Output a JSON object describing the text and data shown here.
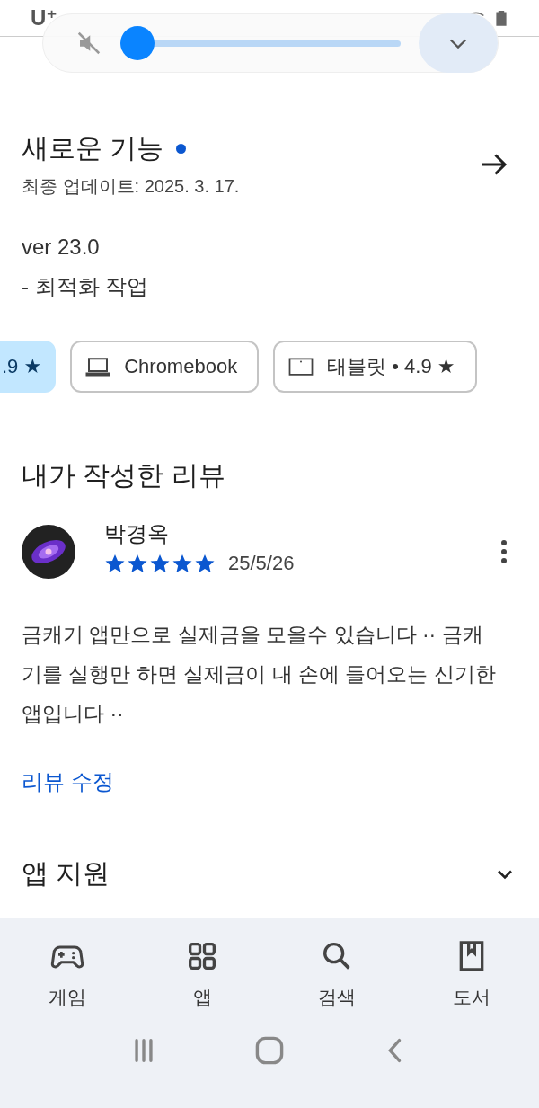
{
  "status_bar": {
    "carrier": "U⁺"
  },
  "volume_panel": {
    "muted": true,
    "level": 0
  },
  "whats_new": {
    "title": "새로운 기능",
    "unread": true,
    "updated": "최종 업데이트: 2025. 3. 17.",
    "version": "ver 23.0",
    "notes": "- 최적화 작업"
  },
  "device_chips": [
    {
      "kind": "phone",
      "label": ".9 ★",
      "selected": true
    },
    {
      "kind": "laptop",
      "label": "Chromebook",
      "selected": false
    },
    {
      "kind": "tablet",
      "label": "태블릿 • 4.9 ★",
      "selected": false
    }
  ],
  "my_review": {
    "heading": "내가 작성한 리뷰",
    "author": "박경옥",
    "stars": 5,
    "date": "25/5/26",
    "text": "금캐기 앱만으로 실제금을 모을수 있습니다 ·· 금캐기를 실행만 하면 실제금이 내 손에 들어오는 신기한 앱입니다 ··",
    "edit_link": "리뷰 수정"
  },
  "app_support": {
    "title": "앱 지원",
    "expanded": false
  },
  "bottom_nav": [
    {
      "kind": "games",
      "label": "게임",
      "selected": false
    },
    {
      "kind": "apps",
      "label": "앱",
      "selected": false
    },
    {
      "kind": "search",
      "label": "검색",
      "selected": false
    },
    {
      "kind": "books",
      "label": "도서",
      "selected": false
    }
  ]
}
